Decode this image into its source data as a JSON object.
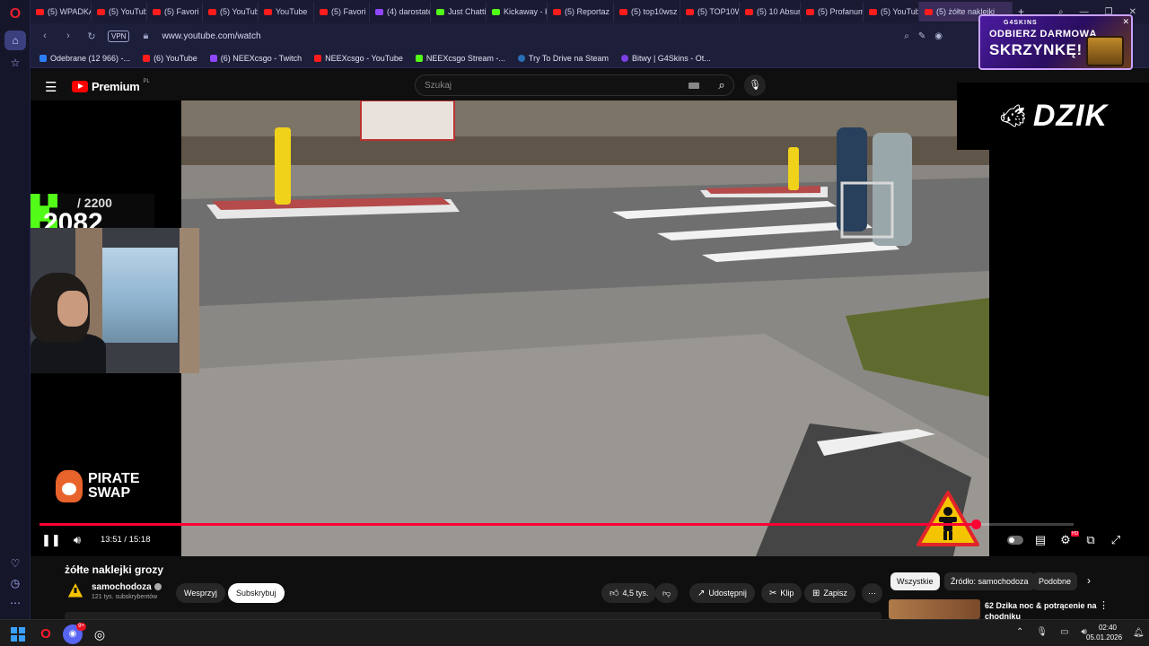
{
  "browser": {
    "tabs": [
      {
        "label": "(5) WPADKA",
        "kind": "yt"
      },
      {
        "label": "(5) YouTube",
        "kind": "yt"
      },
      {
        "label": "(5) Favori",
        "kind": "yt"
      },
      {
        "label": "(5) YouTube",
        "kind": "yt"
      },
      {
        "label": "YouTube",
        "kind": "yt"
      },
      {
        "label": "(5) Favori",
        "kind": "yt"
      },
      {
        "label": "(4) darostate",
        "kind": "tw"
      },
      {
        "label": "Just Chatting",
        "kind": "kk"
      },
      {
        "label": "Kickaway - K",
        "kind": "kk"
      },
      {
        "label": "(5) Reportaz",
        "kind": "yt"
      },
      {
        "label": "(5) top10wsz",
        "kind": "yt"
      },
      {
        "label": "(5) TOP10W",
        "kind": "yt"
      },
      {
        "label": "(5) 10 Absur",
        "kind": "yt"
      },
      {
        "label": "(5) Profanum",
        "kind": "yt"
      },
      {
        "label": "(5) YouTube",
        "kind": "yt"
      },
      {
        "label": "(5) żółte naklejki",
        "kind": "yt"
      }
    ],
    "new_tab": "+",
    "vpn_label": "VPN",
    "url": "www.youtube.com/watch",
    "bookmarks": [
      {
        "label": "Odebrane (12 966) -...",
        "kind": "mail"
      },
      {
        "label": "(6) YouTube",
        "kind": "yt"
      },
      {
        "label": "(6) NEEXcsgo - Twitch",
        "kind": "tw"
      },
      {
        "label": "NEEXcsgo - YouTube",
        "kind": "yt"
      },
      {
        "label": "NEEXcsgo Stream -...",
        "kind": "kk"
      },
      {
        "label": "Try To Drive na Steam",
        "kind": "st"
      },
      {
        "label": "Bitwy | G4Skins - Ot...",
        "kind": "g4"
      }
    ]
  },
  "promo": {
    "brand": "G4SKINS",
    "line1": "ODBIERZ DARMOWĄ",
    "line2": "SKRZYNKĘ!"
  },
  "youtube": {
    "logo_text": "Premium",
    "logo_region": "PL",
    "search_placeholder": "Szukaj"
  },
  "overlays": {
    "dzik_logo": "DZIK",
    "follow_goal": "/ 2200",
    "follow_current": "2082",
    "pirate_swap_line1": "PIRATE",
    "pirate_swap_line2": "SWAP"
  },
  "player": {
    "time_current": "13:51",
    "time_total": "15:18",
    "progress": 0.905
  },
  "video": {
    "title": "żółte naklejki grozy",
    "channel": "samochodoza",
    "subscribers": "121 tys. subskrybentów",
    "support_label": "Wesprzyj",
    "subscribe_label": "Subskrybuj",
    "likes": "4,5 tys.",
    "share_label": "Udostępnij",
    "clip_label": "Klip",
    "save_label": "Zapisz"
  },
  "filter_chips": [
    "Wszystkie",
    "Źródło: samochodoza",
    "Podobne"
  ],
  "recommended": [
    {
      "title": "62 Dzika noc & potrącenie na chodniku"
    }
  ],
  "taskbar": {
    "discord_badge": "9+",
    "time": "02:40",
    "date": "05.01.2026"
  }
}
